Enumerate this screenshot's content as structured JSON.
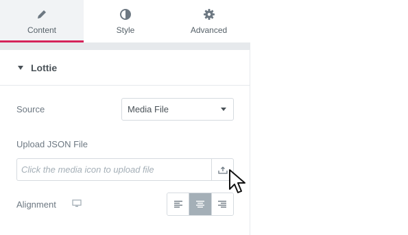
{
  "tabs": [
    {
      "label": "Content",
      "icon": "pencil-icon",
      "active": true
    },
    {
      "label": "Style",
      "icon": "contrast-icon",
      "active": false
    },
    {
      "label": "Advanced",
      "icon": "gear-icon",
      "active": false
    }
  ],
  "section": {
    "title": "Lottie",
    "expanded": true
  },
  "source": {
    "label": "Source",
    "value": "Media File"
  },
  "upload": {
    "label": "Upload JSON File",
    "placeholder": "Click the media icon to upload file",
    "button_icon": "upload-icon"
  },
  "alignment": {
    "label": "Alignment",
    "device_icon": "monitor-icon",
    "options": [
      "left",
      "center",
      "right"
    ],
    "selected": "center"
  },
  "colors": {
    "accent": "#d5235a",
    "text": "#6d7882",
    "heading": "#495157",
    "border": "#d5dadf",
    "active_button": "#a4afb7"
  }
}
